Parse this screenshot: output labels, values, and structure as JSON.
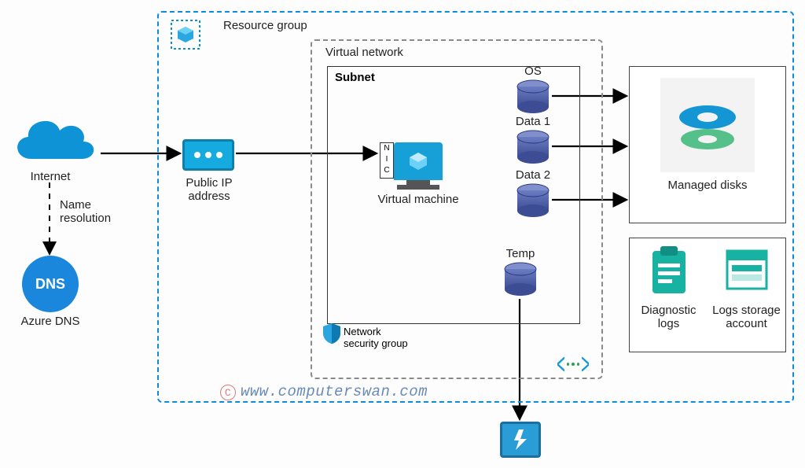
{
  "rg": {
    "label": "Resource group"
  },
  "vnet": {
    "label": "Virtual network"
  },
  "subnet": {
    "label": "Subnet"
  },
  "internet": {
    "label": "Internet"
  },
  "nameres": {
    "label": "Name\nresolution"
  },
  "dns": {
    "badge": "DNS",
    "label": "Azure DNS"
  },
  "publicip": {
    "label": "Public IP\naddress"
  },
  "vm": {
    "label": "Virtual machine",
    "nic": "N\nI\nC"
  },
  "disks": {
    "os": "OS",
    "data1": "Data 1",
    "data2": "Data 2",
    "temp": "Temp"
  },
  "managed": {
    "label": "Managed disks"
  },
  "diag": {
    "label": "Diagnostic\nlogs"
  },
  "logs": {
    "label": "Logs storage\naccount"
  },
  "nsg": {
    "label": "Network\nsecurity group"
  },
  "watermark": {
    "text": "www.computerswan.com"
  }
}
